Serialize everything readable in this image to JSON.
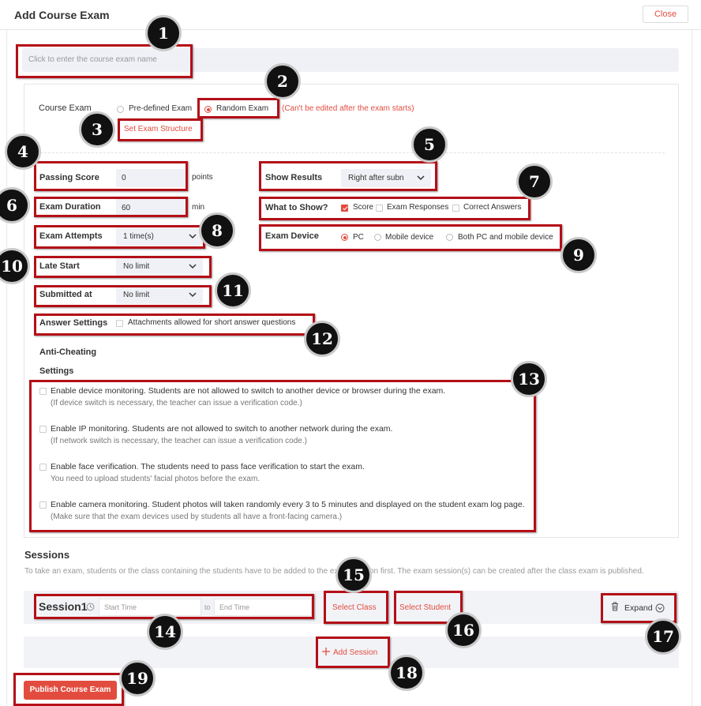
{
  "header": {
    "title": "Add Course Exam",
    "close_label": "Close"
  },
  "name_input": {
    "placeholder": "Click to enter the course exam name"
  },
  "course_exam": {
    "label": "Course Exam",
    "options": [
      "Pre-defined Exam",
      "Random Exam"
    ],
    "selected": "Random Exam",
    "note": "(Can't be edited after the exam starts)",
    "structure_link": "Set Exam Structure"
  },
  "passing_score": {
    "label": "Passing Score",
    "value": "0",
    "unit": "points"
  },
  "exam_duration": {
    "label": "Exam Duration",
    "value": "60",
    "unit": "min"
  },
  "exam_attempts": {
    "label": "Exam Attempts",
    "value": "1 time(s)"
  },
  "late_start": {
    "label": "Late Start",
    "value": "No limit"
  },
  "submitted_at": {
    "label": "Submitted at",
    "value": "No limit"
  },
  "answer_settings": {
    "label": "Answer Settings",
    "option": "Attachments allowed for short answer questions"
  },
  "show_results": {
    "label": "Show Results",
    "value": "Right after subn"
  },
  "what_to_show": {
    "label": "What to Show?",
    "options": [
      "Score",
      "Exam Responses",
      "Correct Answers"
    ],
    "checked": [
      "Score"
    ]
  },
  "exam_device": {
    "label": "Exam Device",
    "options": [
      "PC",
      "Mobile device",
      "Both PC and mobile device"
    ],
    "selected": "PC"
  },
  "anti_cheating": {
    "label_line1": "Anti-Cheating",
    "label_line2": "Settings",
    "items": [
      {
        "text": "Enable device monitoring. Students are not allowed to switch to another device or browser during the exam.",
        "note": "(If device switch is necessary, the teacher can issue a verification code.)"
      },
      {
        "text": "Enable IP monitoring. Students are not allowed to switch to another network during the exam.",
        "note": "(If network switch is necessary, the teacher can issue a verification code.)"
      },
      {
        "text": "Enable face verification. The students need to pass face verification to start the exam.",
        "note": "You need to upload students' facial photos before the exam."
      },
      {
        "text": "Enable camera monitoring. Student photos will taken randomly every 3 to 5 minutes and displayed on the student exam log page.",
        "note": "(Make sure that the exam devices used by students all have a front-facing camera.)"
      }
    ]
  },
  "sessions": {
    "title": "Sessions",
    "note": "To take an exam, students or the class containing the students have to be added to the exam session first. The exam session(s) can be created after the class exam is published.",
    "session_label": "Session1",
    "start_placeholder": "Start Time",
    "to_label": "to",
    "end_placeholder": "End Time",
    "select_class": "Select Class",
    "select_student": "Select Student",
    "expand": "Expand",
    "add_session": "Add Session"
  },
  "publish_label": "Publish Course Exam",
  "badges": [
    "1",
    "2",
    "3",
    "4",
    "5",
    "6",
    "7",
    "8",
    "9",
    "10",
    "11",
    "12",
    "13",
    "14",
    "15",
    "16",
    "17",
    "18",
    "19"
  ],
  "colors": {
    "accent": "#e24c3f",
    "highlight": "#b40f17",
    "field_bg": "#f0f1f6"
  }
}
